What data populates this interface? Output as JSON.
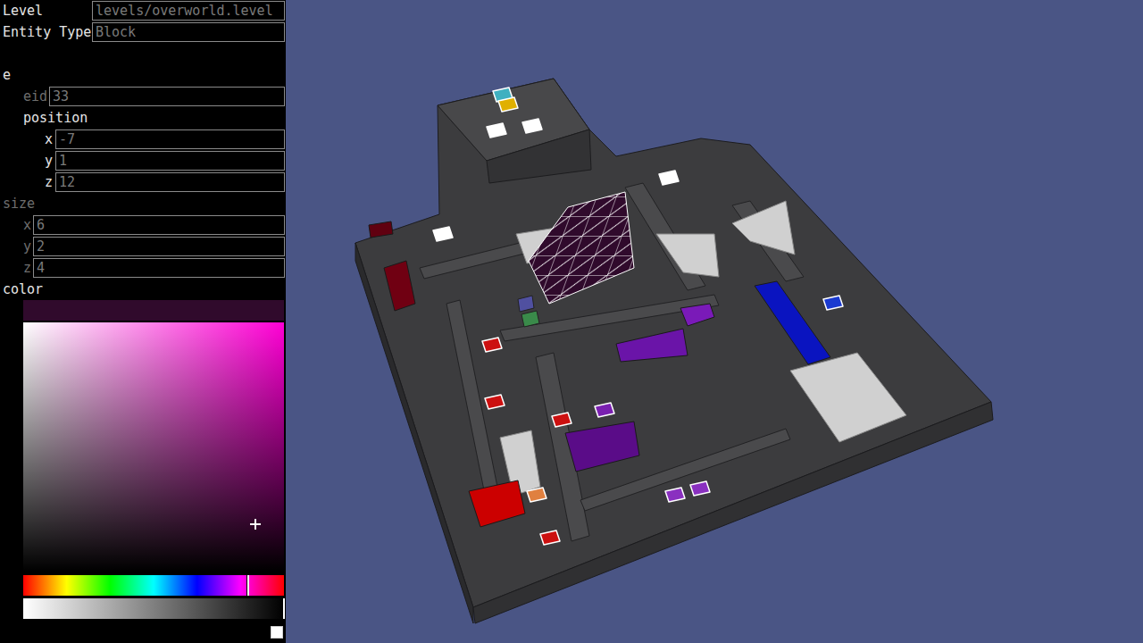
{
  "panel": {
    "rows": [
      {
        "label": "Level",
        "value": "levels/overworld.level"
      },
      {
        "label": "Entity Type",
        "value": "Block"
      }
    ],
    "entity": {
      "label": "e",
      "eid": {
        "label": "eid",
        "value": "33",
        "disabled": true
      },
      "position": {
        "label": "position",
        "disabled": false,
        "fields": [
          {
            "label": "x",
            "value": "-7"
          },
          {
            "label": "y",
            "value": "1"
          },
          {
            "label": "z",
            "value": "12"
          }
        ]
      },
      "size": {
        "label": "size",
        "disabled": true,
        "fields": [
          {
            "label": "x",
            "value": "6"
          },
          {
            "label": "y",
            "value": "2"
          },
          {
            "label": "z",
            "value": "4"
          }
        ]
      }
    },
    "color": {
      "label": "color",
      "swatch": "#300a2c",
      "hue": 0.86,
      "saturation": 0.89,
      "value": 0.19,
      "brightness": 1.0
    },
    "checkbox": {
      "checked": false
    }
  },
  "scene": {
    "objects": [
      {
        "kind": "floor",
        "color": "#3c3c3e"
      },
      {
        "kind": "floor",
        "color": "#2a2a2c"
      },
      {
        "kind": "floor",
        "color": "#303032"
      },
      {
        "kind": "floor",
        "color": "#48484a"
      },
      {
        "kind": "floor",
        "color": "#323234"
      },
      {
        "kind": "wall",
        "color": "#4a4a4c"
      },
      {
        "kind": "wall",
        "color": "#4a4a4c"
      },
      {
        "kind": "wall",
        "color": "#4a4a4c"
      },
      {
        "kind": "wall",
        "color": "#4a4a4c"
      },
      {
        "kind": "wall",
        "color": "#4a4a4c"
      },
      {
        "kind": "wall",
        "color": "#4a4a4c"
      },
      {
        "kind": "wall",
        "color": "#4a4a4c"
      },
      {
        "kind": "tile",
        "color": "#d0d0d0"
      },
      {
        "kind": "tile",
        "color": "#d0d0d0"
      },
      {
        "kind": "tile",
        "color": "#d0d0d0"
      },
      {
        "kind": "tile",
        "color": "#d0d0d0"
      },
      {
        "kind": "tile",
        "color": "#d0d0d0"
      },
      {
        "kind": "selected-block",
        "color": "#300a2c"
      },
      {
        "kind": "block",
        "color": "#0a14c0"
      },
      {
        "kind": "block",
        "color": "#6a14a8"
      },
      {
        "kind": "block",
        "color": "#5a0c88"
      },
      {
        "kind": "block",
        "color": "#7a1ab8"
      },
      {
        "kind": "block",
        "color": "#cc0000"
      },
      {
        "kind": "block",
        "color": "#700012"
      },
      {
        "kind": "block",
        "color": "#600010"
      },
      {
        "kind": "cube",
        "color": "#5050a0"
      },
      {
        "kind": "cube",
        "color": "#3a8a4a"
      },
      {
        "kind": "marker",
        "color": "#ffffff"
      },
      {
        "kind": "marker",
        "color": "#cc1010"
      },
      {
        "kind": "marker",
        "color": "#cc1010"
      },
      {
        "kind": "marker",
        "color": "#cc1010"
      },
      {
        "kind": "marker",
        "color": "#7a20b0"
      },
      {
        "kind": "marker",
        "color": "#8a30c0"
      },
      {
        "kind": "marker",
        "color": "#8a30c0"
      },
      {
        "kind": "marker",
        "color": "#cc1010"
      },
      {
        "kind": "marker",
        "color": "#1a3ad0"
      },
      {
        "kind": "marker",
        "color": "#ffffff"
      },
      {
        "kind": "marker",
        "color": "#ffffff"
      },
      {
        "kind": "marker",
        "color": "#ffffff"
      },
      {
        "kind": "marker",
        "color": "#40b0c0"
      },
      {
        "kind": "marker",
        "color": "#e0b000"
      },
      {
        "kind": "marker",
        "color": "#e08040"
      }
    ]
  }
}
